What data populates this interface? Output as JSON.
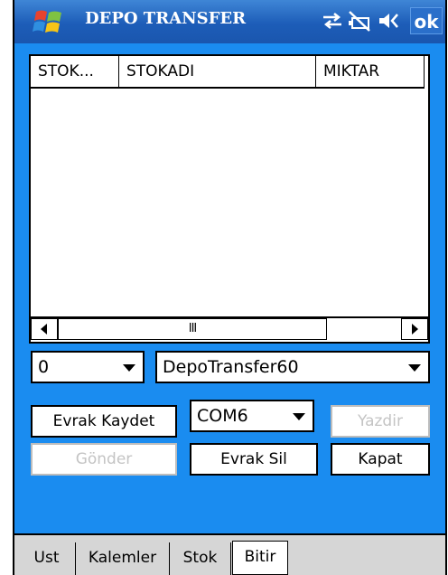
{
  "titlebar": {
    "title": "DEPO TRANSFER",
    "ok_label": "ok",
    "icons": [
      "windows-start-icon",
      "connectivity-icon",
      "battery-icon",
      "speaker-icon"
    ]
  },
  "listview": {
    "columns": [
      "STOK...",
      "STOKADI",
      "MIKTAR"
    ],
    "rows": [],
    "scrollbar_thumb": "III"
  },
  "form": {
    "warehouse_value": "0",
    "document_value": "DepoTransfer60",
    "port_value": "COM6",
    "buttons": {
      "save": "Evrak Kaydet",
      "print": "Yazdir",
      "send": "Gönder",
      "delete": "Evrak Sil",
      "close": "Kapat"
    }
  },
  "tabs": [
    "Ust",
    "Kalemler",
    "Stok",
    "Bitir"
  ],
  "active_tab": "Bitir",
  "colors": {
    "title_bar": "#1d5db8",
    "background": "#1a8cf0",
    "tab_bar": "#d6d6d6",
    "disabled_text": "#c4c4c4"
  }
}
